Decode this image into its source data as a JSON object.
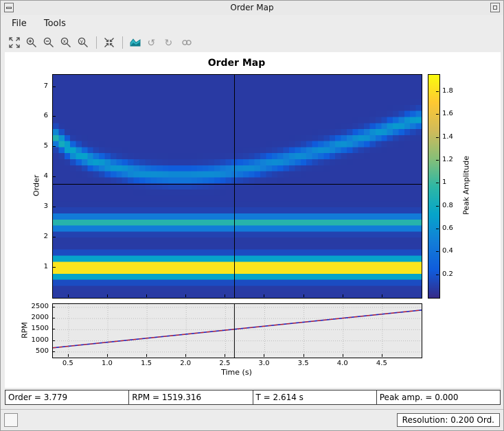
{
  "window": {
    "title": "Order Map"
  },
  "menu": {
    "items": [
      {
        "label": "File"
      },
      {
        "label": "Tools"
      }
    ]
  },
  "toolbar": {
    "icons": [
      "fit-view",
      "zoom-in",
      "zoom-out",
      "zoom-x",
      "zoom-y",
      "restore-view",
      "colormap",
      "undo-view",
      "redo-view",
      "link-axes"
    ]
  },
  "status_row": {
    "order": "Order = 3.779",
    "rpm": "RPM = 1519.316",
    "time": "T = 2.614 s",
    "peak": "Peak amp. = 0.000"
  },
  "statusbar": {
    "resolution": "Resolution: 0.200 Ord."
  },
  "colors": {
    "window_bg": "#ececec",
    "figure_bg": "#ffffff",
    "rpm_axes_bg": "#e9e9e9",
    "crosshair": "#000000",
    "rpm_line_blue": "#2222bb",
    "rpm_line_red": "#cc2222"
  },
  "chart_data": [
    {
      "type": "heatmap",
      "title": "Order Map",
      "ylabel": "Order",
      "xlim": [
        0.3,
        5.0
      ],
      "ylim": [
        0,
        7.4
      ],
      "ytick_values": [
        1,
        2,
        3,
        4,
        5,
        6,
        7
      ],
      "ytick_labels": [
        "1",
        "2",
        "3",
        "4",
        "5",
        "6",
        "7"
      ],
      "order_resolution": 0.2,
      "time_bins": 64,
      "clim": [
        0,
        1.95
      ],
      "noise_floor": 0.08,
      "colorbar": {
        "label": "Peak Amplitude",
        "tick_values": [
          0.2,
          0.4,
          0.6,
          0.8,
          1.0,
          1.2,
          1.4,
          1.6,
          1.8
        ],
        "tick_labels": [
          "0.2",
          "0.4",
          "0.6",
          "0.8",
          "1",
          "1.2",
          "1.4",
          "1.6",
          "1.8"
        ]
      },
      "colormap_parula": [
        "#352a87",
        "#0f5cdd",
        "#127dd8",
        "#06a4ca",
        "#2eb7a4",
        "#87bf77",
        "#d1bb59",
        "#fec832",
        "#f9fb0e"
      ],
      "components": [
        {
          "name": "order-1-harmonic",
          "type": "constant-order",
          "order": 1.0,
          "amplitude": 2.0,
          "sigma": 0.2
        },
        {
          "name": "order-2p5-harmonic",
          "type": "constant-order",
          "order": 2.5,
          "amplitude": 0.85,
          "sigma": 0.16
        },
        {
          "name": "fixed-frequency-tone",
          "type": "curve",
          "sigma": 0.17,
          "t": [
            0.3,
            0.55,
            0.8,
            1.05,
            1.3,
            1.55,
            1.8,
            2.05,
            2.3,
            2.55,
            2.8,
            3.05,
            3.3,
            3.55,
            3.8,
            4.05,
            4.3,
            4.55,
            4.8,
            5.0
          ],
          "order": [
            5.4,
            4.85,
            4.55,
            4.35,
            4.2,
            4.1,
            4.05,
            4.05,
            4.1,
            4.2,
            4.3,
            4.45,
            4.6,
            4.78,
            4.95,
            5.15,
            5.35,
            5.58,
            5.8,
            5.95
          ],
          "amplitude": [
            0.85,
            0.7,
            0.62,
            0.58,
            0.55,
            0.52,
            0.5,
            0.5,
            0.5,
            0.5,
            0.5,
            0.5,
            0.5,
            0.5,
            0.52,
            0.54,
            0.56,
            0.58,
            0.6,
            0.62
          ]
        }
      ],
      "crosshair": {
        "time": 2.614,
        "order": 3.779
      }
    },
    {
      "type": "line",
      "ylabel": "RPM",
      "xlabel": "Time (s)",
      "xlim": [
        0.3,
        5.0
      ],
      "ylim": [
        250,
        2650
      ],
      "ytick_values": [
        500,
        1000,
        1500,
        2000,
        2500
      ],
      "ytick_labels": [
        "500",
        "1000",
        "1500",
        "2000",
        "2500"
      ],
      "xtick_values": [
        0.5,
        1.0,
        1.5,
        2.0,
        2.5,
        3.0,
        3.5,
        4.0,
        4.5
      ],
      "xtick_labels": [
        "0.5",
        "1.0",
        "1.5",
        "2.0",
        "2.5",
        "3.0",
        "3.5",
        "4.0",
        "4.5"
      ],
      "grid": true,
      "series": [
        {
          "name": "rpm-profile",
          "x": [
            0.3,
            5.0
          ],
          "y": [
            686,
            2378
          ]
        }
      ],
      "crosshair_time": 2.614
    }
  ]
}
